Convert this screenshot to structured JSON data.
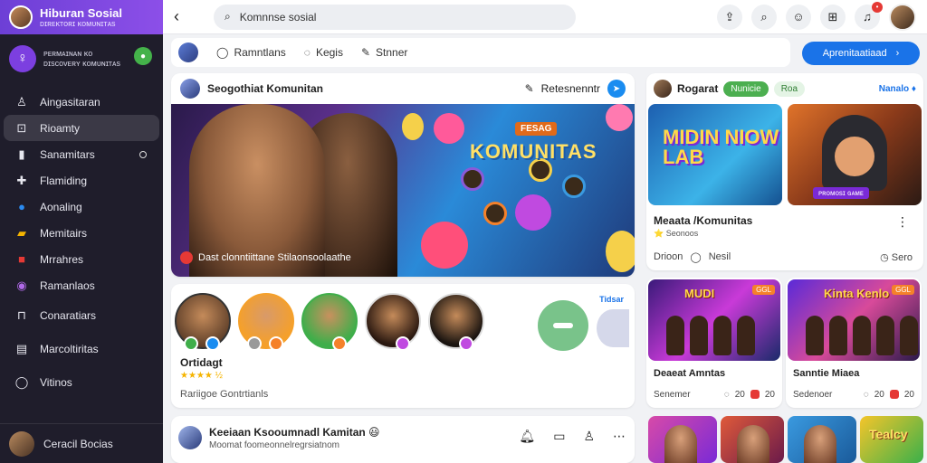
{
  "sidebar": {
    "header_title": "Hiburan Sosial",
    "header_sub": "ᴅɪʀᴇᴋᴛᴏʀɪ ᴋᴏᴍᴜɴɪᴛᴀs",
    "profile_line1": "ᴘᴇʀᴍᴀɪɴᴀɴ ᴋᴏ",
    "profile_line2": "ᴅɪsᴄᴏᴠᴇʀʏ ᴋᴏᴍᴜɴɪᴛᴀs",
    "items": [
      {
        "label": "Aingasitaran",
        "icon": "person-icon"
      },
      {
        "label": "Rioamty",
        "icon": "tag-icon"
      },
      {
        "label": "Sanamitars",
        "icon": "bookmark-icon"
      },
      {
        "label": "Flamiding",
        "icon": "puzzle-icon"
      },
      {
        "label": "Aonaling",
        "icon": "globe-icon"
      },
      {
        "label": "Memitairs",
        "icon": "flag-icon"
      },
      {
        "label": "Mrrahres",
        "icon": "chat-icon"
      },
      {
        "label": "Ramanlaos",
        "icon": "circle-icon"
      },
      {
        "label": "Conaratiars",
        "icon": "briefcase-icon"
      },
      {
        "label": "Marcoltiritas",
        "icon": "grid-icon"
      },
      {
        "label": "Vitinos",
        "icon": "message-icon"
      }
    ],
    "footer_label": "Ceracil Bocias"
  },
  "topbar": {
    "search_value": "Komnnse sosial"
  },
  "composer": {
    "actions": [
      "Ramntlans",
      "Kegis",
      "Stnner"
    ],
    "primary_button": "Aprenitaatiaad"
  },
  "post": {
    "title": "Seogothiat Komunitan",
    "action": "Retesnenntr",
    "banner_title": "KOMUNITAS",
    "banner_badge": "FESAG",
    "caption": "Dast clonntiittane Stilaonsoolaathe"
  },
  "members": {
    "link": "Tidsar",
    "name": "Ortidagt",
    "stars": "★★★★ ½",
    "footer": "Rariigoe Gontrtianls"
  },
  "chat": {
    "title": "Keeiaan Ksooumnadl Kamitan 😃",
    "subtitle": "Moomat foomeonnelregrsiatnom"
  },
  "right_header": {
    "title": "Rogarat",
    "pill1": "Nunicie",
    "pill2": "Roa",
    "link": "Nanalo ♦"
  },
  "feature": {
    "game1_title": "MIDIN NIOW LAB",
    "game2_bar": "ᴘʀᴏᴍᴏsɪ ɢᴀᴍᴇ",
    "title": "Meaata /Komunitas",
    "sub": "⭐ Seonoos",
    "footer_left": "Drioon",
    "footer_mid": "Nesil",
    "footer_right": "Sero"
  },
  "cards": [
    {
      "title": "Deaeat Amntas",
      "banner": "MUDI",
      "chip": "GGL",
      "foot_left": "Senemer",
      "foot_mid": "20",
      "foot_right": "20"
    },
    {
      "title": "Sanntie Miaea",
      "banner": "Kinta Kenlo",
      "chip": "GGL",
      "foot_left": "Sedenoer",
      "foot_mid": "20",
      "foot_right": "20"
    }
  ],
  "strip": {
    "last_label": "Tealcy"
  }
}
